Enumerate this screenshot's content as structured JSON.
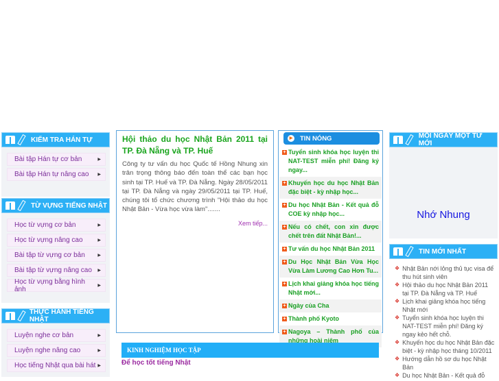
{
  "left_panels": [
    {
      "title": "KIỂM TRA HÁN TỰ",
      "items": [
        "Bài tập Hán tự cơ bản",
        "Bài tập Hán tự nâng cao"
      ]
    },
    {
      "title": "TỪ VỰNG TIẾNG NHẬT",
      "items": [
        "Học từ vựng cơ bản",
        "Học từ vựng nâng cao",
        "Bài tập từ vựng cơ bản",
        "Bài tập từ vựng nâng cao",
        "Học từ vựng bằng hình ảnh"
      ]
    },
    {
      "title": "THỰC HÀNH TIẾNG NHẬT",
      "items": [
        "Luyện nghe cơ bản",
        "Luyện nghe nâng cao",
        "Học tiếng Nhật qua bài hát"
      ]
    }
  ],
  "article": {
    "title": "Hội thảo du học Nhật Bản 2011 tại TP. Đà Nẵng và TP. Huế",
    "body": "Công ty tư vấn du học Quốc tế Hồng Nhung xin trân trọng thông báo đến toàn thể các bạn học sinh tại TP. Huế và TP. Đà Nẵng. Ngày 28/05/2011 tại TP. Đà Nẵng và ngày 29/05/2011 tại TP. Huế, chúng tôi tổ chức chương trình \"Hội thảo du học Nhật Bản - Vừa học vừa làm\".......",
    "more": "Xem tiếp..."
  },
  "hot_news": {
    "title": "TIN NÓNG",
    "items": [
      "Tuyển sinh khóa học luyện thi NAT-TEST miễn phí! Đăng ký ngay...",
      "Khuyến học du học Nhật Bản đặc biệt - kỳ nhập học...",
      "Du học Nhật Bản - Kết quả đỗ COE kỳ nhập học...",
      "Nếu có chết, con xin được chết trên đất Nhật Bản!...",
      "Tư vấn du học Nhật Bản 2011",
      "Du Học Nhật Bản Vừa Học Vừa Làm Lương Cao Hơn Tu...",
      "Lịch khai giảng khóa học tiếng Nhật mới...",
      "Ngày của Cha",
      "Thành phố Kyoto",
      "Nagoya – Thành phố của những hoài niệm"
    ]
  },
  "experience": {
    "title": "KINH NGHIỆM HỌC TẬP",
    "first": "Để học tốt tiếng Nhật"
  },
  "word_of_day": {
    "title": "MỖI NGÀY MỘT TỪ MỚI",
    "word": "Nhớ Nhung"
  },
  "latest": {
    "title": "TIN MỚI NHẤT",
    "items": [
      "Nhật Bản nới lỏng thủ tục visa để thu hút sinh viên",
      "Hội thảo du học Nhật Bản 2011 tại TP. Đà Nẵng và TP. Huế",
      "Lịch khai giảng khóa học tiếng Nhật mới",
      "Tuyển sinh khóa học luyện thi NAT-TEST miễn phí! Đăng ký ngay kẻo hết chỗ.",
      "Khuyến học du học Nhật Bản đặc biệt - kỳ nhập học tháng 10/2011",
      "Hướng dẫn hồ sơ du học Nhật Bản",
      "Du học Nhật Bản - Kết quả đỗ"
    ]
  }
}
